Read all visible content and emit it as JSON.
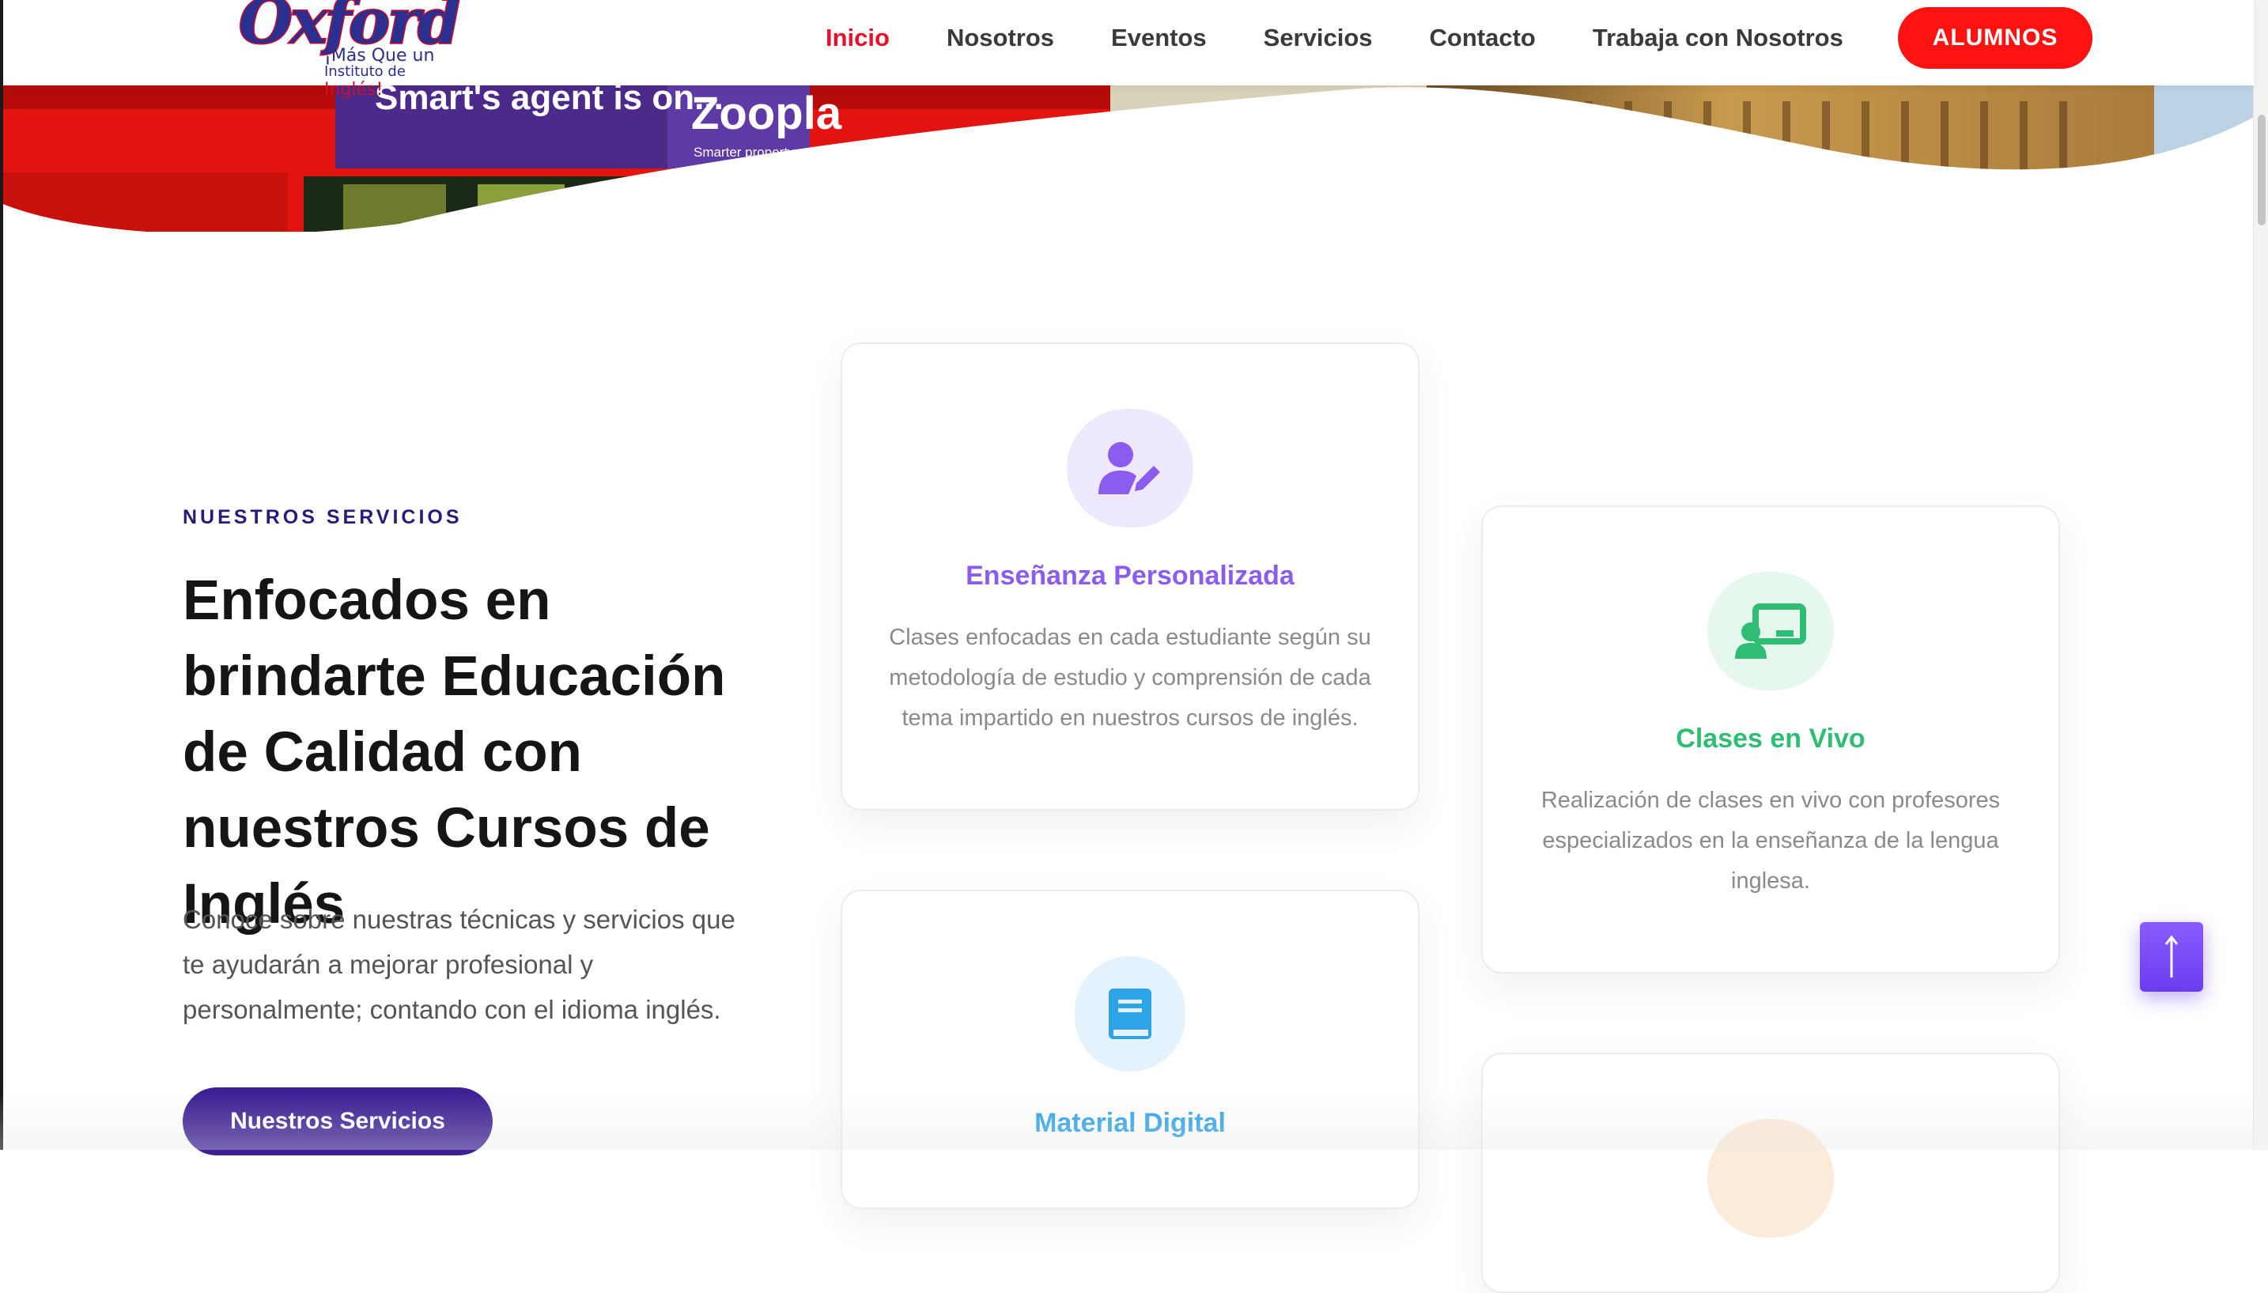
{
  "header": {
    "logo": {
      "brand": "Oxford",
      "tagline_line1": "¡Más Que un",
      "tagline_line2": "Instituto de",
      "tagline_accent": "Inglés!"
    },
    "nav": [
      {
        "label": "Inicio",
        "active": true
      },
      {
        "label": "Nosotros",
        "active": false
      },
      {
        "label": "Eventos",
        "active": false
      },
      {
        "label": "Servicios",
        "active": false
      },
      {
        "label": "Contacto",
        "active": false
      },
      {
        "label": "Trabaja con Nosotros",
        "active": false
      }
    ],
    "cta_label": "ALUMNOS"
  },
  "hero": {
    "banner_text_1": "Smart's agent is on...",
    "banner_brand": "Zoopla",
    "banner_sub": "Smarter property search"
  },
  "services_intro": {
    "eyebrow": "NUESTROS SERVICIOS",
    "headline": "Enfocados en brindarte Educación de Calidad con nuestros Cursos de Inglés",
    "lede": "Conoce sobre nuestras técnicas y servicios que te ayudarán a mejorar profesional y personalmente; contando con el idioma inglés.",
    "button_label": "Nuestros Servicios"
  },
  "cards": [
    {
      "title": "Enseñanza Personalizada",
      "text": "Clases enfocadas en cada estudiante según su metodología de estudio y comprensión de cada tema impartido en nuestros cursos de inglés.",
      "icon": "user-edit-icon",
      "color": "#8a5cf0"
    },
    {
      "title": "Clases en Vivo",
      "text": "Realización de clases en vivo con profesores especializados en la enseñanza de la lengua inglesa.",
      "icon": "chalkboard-teacher-icon",
      "color": "#2fbd74"
    },
    {
      "title": "Material Digital",
      "icon": "book-icon",
      "color": "#2ea3e6"
    },
    {
      "icon": "service-icon",
      "color": "#f3a25a"
    }
  ],
  "colors": {
    "accent_red": "#ff1212",
    "brand_purple": "#3b1f94",
    "scroll_top": "#7a4cf8"
  }
}
